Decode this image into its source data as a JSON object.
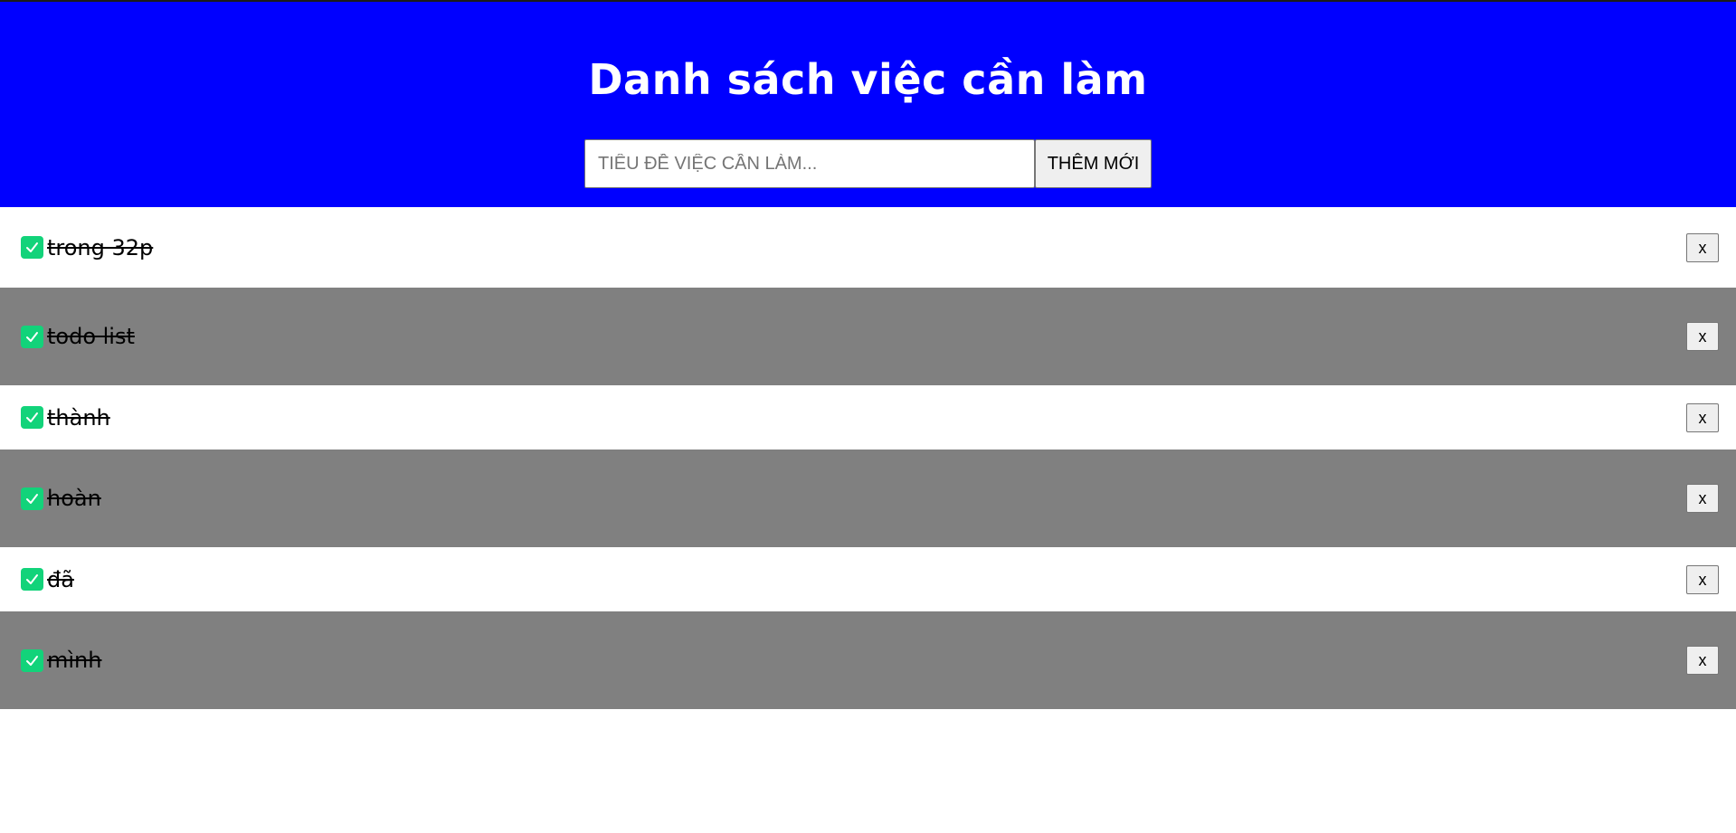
{
  "header": {
    "title": "Danh sách việc cần làm",
    "input_placeholder": "TIÊU ĐỀ VIỆC CẦN LÀM...",
    "input_value": "",
    "add_button_label": "THÊM MỚI"
  },
  "todos": [
    {
      "title": "trong 32p",
      "completed": true,
      "delete_label": "x"
    },
    {
      "title": "todo list",
      "completed": true,
      "delete_label": "x"
    },
    {
      "title": "thành",
      "completed": true,
      "delete_label": "x"
    },
    {
      "title": "hoàn",
      "completed": true,
      "delete_label": "x"
    },
    {
      "title": "đã",
      "completed": true,
      "delete_label": "x"
    },
    {
      "title": "mình",
      "completed": true,
      "delete_label": "x"
    }
  ],
  "colors": {
    "header_bg": "#0000ff",
    "header_text": "#ffffff",
    "row_even_bg": "#ffffff",
    "row_odd_bg": "#808080",
    "check_green": "#12d37a"
  },
  "icons": {
    "check": "checkmark-icon"
  }
}
